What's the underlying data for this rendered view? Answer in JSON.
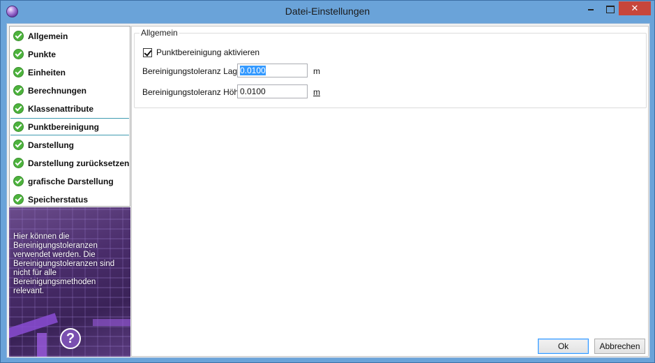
{
  "window": {
    "title": "Datei-Einstellungen"
  },
  "nav": {
    "items": [
      {
        "label": "Allgemein"
      },
      {
        "label": "Punkte"
      },
      {
        "label": "Einheiten"
      },
      {
        "label": "Berechnungen"
      },
      {
        "label": "Klassenattribute"
      },
      {
        "label": "Punktbereinigung",
        "selected": true
      },
      {
        "label": "Darstellung"
      },
      {
        "label": "Darstellung zurücksetzen"
      },
      {
        "label": "grafische Darstellung"
      },
      {
        "label": "Speicherstatus"
      }
    ],
    "icon": "green-check-icon"
  },
  "help": {
    "text": "Hier können die Bereinigungstoleranzen verwendet werden. Die Bereinigungstoleranzen sind nicht für alle Bereinigungsmethoden relevant.",
    "icon": "question-mark-icon"
  },
  "group": {
    "title": "Allgemein",
    "checkbox_label": "Punktbereinigung aktivieren",
    "checkbox_checked": true,
    "lage_label": "Bereinigungstoleranz Lage",
    "lage_value": "0.0100",
    "lage_unit": "m",
    "hoehe_label": "Bereinigungstoleranz Höhe",
    "hoehe_value": "0.0100",
    "hoehe_unit": "m"
  },
  "buttons": {
    "ok": "Ok",
    "cancel": "Abbrechen"
  }
}
